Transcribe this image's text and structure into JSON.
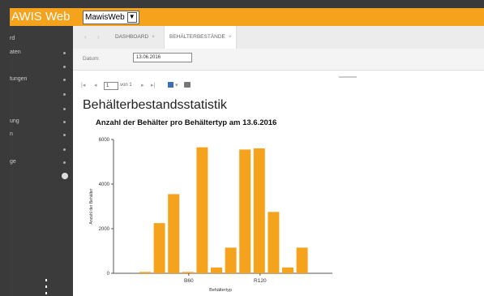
{
  "app": {
    "brand": "AWIS Web",
    "selector_value": "MawisWeb"
  },
  "sidebar": {
    "items": [
      {
        "label": "rd",
        "dot": false
      },
      {
        "label": "aten",
        "dot": true
      },
      {
        "label": "",
        "dot": true
      },
      {
        "label": "tungen",
        "dot": true
      },
      {
        "label": "",
        "dot": true
      },
      {
        "label": "",
        "dot": true
      },
      {
        "label": "ung",
        "dot": true
      },
      {
        "label": "n",
        "dot": true
      },
      {
        "label": "",
        "dot": true
      },
      {
        "label": "ge",
        "dot": true
      }
    ]
  },
  "tabs": {
    "nav_prev": "‹",
    "nav_next": "›",
    "dashboard": "DASHBOARD",
    "active": "BEHÄLTERBESTÄNDE",
    "close": "×"
  },
  "params": {
    "datum_label": "Datum:",
    "datum_value": "13.06.2016"
  },
  "toolbar": {
    "first": "|◂",
    "prev": "◂",
    "page_value": "1",
    "of_text": "von 1",
    "next": "▸",
    "last": "▸|",
    "save_caret": "▾"
  },
  "report": {
    "title": "Behälterbestandsstatistik"
  },
  "chart_data": {
    "type": "bar",
    "title": "Anzahl der Behälter pro Behältertyp am 13.6.2016",
    "xlabel": "Behältertyp",
    "ylabel": "Anzahl der Behälter",
    "ylim": [
      0,
      6000
    ],
    "yticks": [
      0,
      2000,
      4000,
      6000
    ],
    "grid": false,
    "legend": "none",
    "bar_color": "#f5a21c",
    "categories": [
      "",
      "",
      "",
      "B60",
      "",
      "",
      "",
      "",
      "R120",
      "",
      "",
      "",
      ""
    ],
    "values": [
      60,
      2250,
      3550,
      60,
      5650,
      260,
      1150,
      5550,
      5600,
      2750,
      260,
      1150,
      0
    ],
    "tick_labels": [
      {
        "label": "B60",
        "after_bar": 3
      },
      {
        "label": "R120",
        "after_bar": 8
      }
    ]
  }
}
